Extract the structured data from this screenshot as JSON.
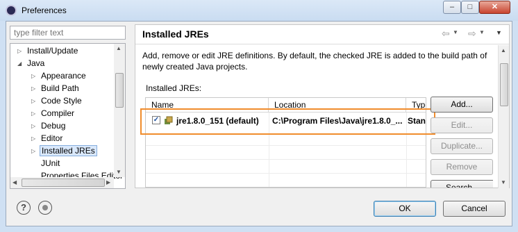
{
  "window": {
    "title": "Preferences",
    "minimize": "–",
    "maximize": "□",
    "close": "✕"
  },
  "filter": {
    "placeholder": "type filter text"
  },
  "tree": {
    "items": [
      {
        "label": "Install/Update",
        "twisty": "▷"
      },
      {
        "label": "Java",
        "twisty": "◢"
      },
      {
        "label": "Appearance",
        "twisty": "▷"
      },
      {
        "label": "Build Path",
        "twisty": "▷"
      },
      {
        "label": "Code Style",
        "twisty": "▷"
      },
      {
        "label": "Compiler",
        "twisty": "▷"
      },
      {
        "label": "Debug",
        "twisty": "▷"
      },
      {
        "label": "Editor",
        "twisty": "▷"
      },
      {
        "label": "Installed JREs",
        "twisty": "▷"
      },
      {
        "label": "JUnit",
        "twisty": ""
      },
      {
        "label": "Properties Files Editor",
        "twisty": ""
      }
    ]
  },
  "page": {
    "title": "Installed JREs",
    "description": "Add, remove or edit JRE definitions. By default, the checked JRE is added to the build path of newly created Java projects.",
    "table_label": "Installed JREs:",
    "columns": [
      "Name",
      "Location",
      "Type"
    ],
    "rows": [
      {
        "checked": true,
        "name": "jre1.8.0_151 (default)",
        "location": "C:\\Program Files\\Java\\jre1.8.0_...",
        "type": "Stand"
      }
    ]
  },
  "buttons": {
    "add": "Add...",
    "edit": "Edit...",
    "duplicate": "Duplicate...",
    "remove": "Remove",
    "search": "Search...",
    "ok": "OK",
    "cancel": "Cancel"
  },
  "colors": {
    "highlight": "#f08c2c",
    "selection": "#d9e8fb"
  }
}
